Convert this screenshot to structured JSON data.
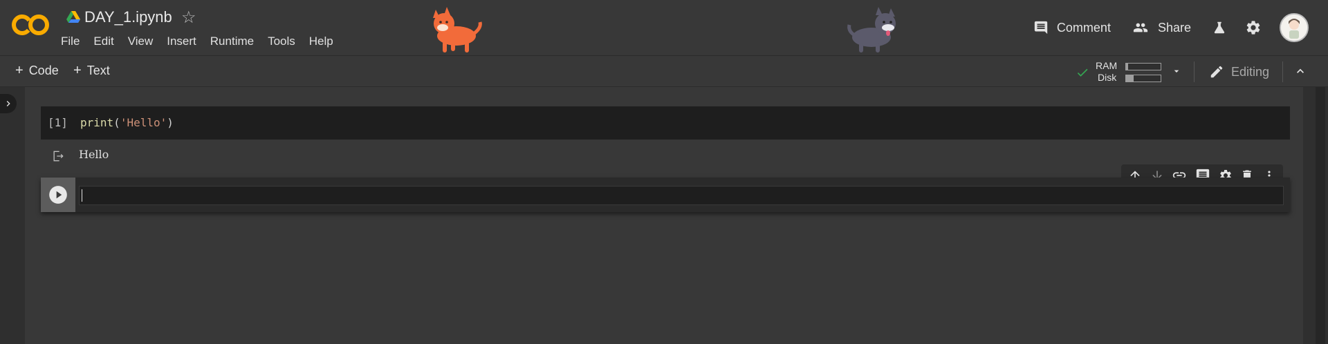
{
  "header": {
    "notebook_title": "DAY_1.ipynb",
    "logo_text": "CO",
    "menu": [
      "File",
      "Edit",
      "View",
      "Insert",
      "Runtime",
      "Tools",
      "Help"
    ],
    "comment_label": "Comment",
    "share_label": "Share"
  },
  "toolbar": {
    "code_label": "Code",
    "text_label": "Text",
    "ram_label": "RAM",
    "disk_label": "Disk",
    "ram_usage": 0.05,
    "disk_usage": 0.22,
    "editing_label": "Editing"
  },
  "cells": [
    {
      "execution_count": "[1]",
      "code_fn": "print",
      "code_open": "(",
      "code_string": "'Hello'",
      "code_close": ")",
      "output": "Hello"
    },
    {
      "execution_count": "",
      "code": ""
    }
  ],
  "colors": {
    "background": "#383838",
    "cell_bg": "#1e1e1e",
    "logo_orange": "#f9ab00",
    "ok_green": "#34a853"
  }
}
